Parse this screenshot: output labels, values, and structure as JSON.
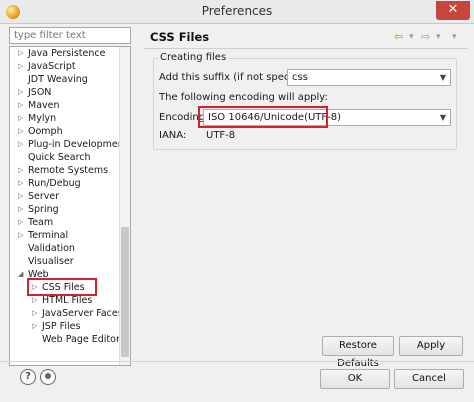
{
  "window": {
    "title": "Preferences",
    "close_glyph": "✕"
  },
  "tree": {
    "filter_placeholder": "type filter text",
    "items": [
      {
        "label": "Java Persistence",
        "expandable": true,
        "depth": 0
      },
      {
        "label": "JavaScript",
        "expandable": true,
        "depth": 0
      },
      {
        "label": "JDT Weaving",
        "expandable": false,
        "depth": 0
      },
      {
        "label": "JSON",
        "expandable": true,
        "depth": 0
      },
      {
        "label": "Maven",
        "expandable": true,
        "depth": 0
      },
      {
        "label": "Mylyn",
        "expandable": true,
        "depth": 0
      },
      {
        "label": "Oomph",
        "expandable": true,
        "depth": 0
      },
      {
        "label": "Plug-in Development",
        "expandable": true,
        "depth": 0
      },
      {
        "label": "Quick Search",
        "expandable": false,
        "depth": 0
      },
      {
        "label": "Remote Systems",
        "expandable": true,
        "depth": 0
      },
      {
        "label": "Run/Debug",
        "expandable": true,
        "depth": 0
      },
      {
        "label": "Server",
        "expandable": true,
        "depth": 0
      },
      {
        "label": "Spring",
        "expandable": true,
        "depth": 0
      },
      {
        "label": "Team",
        "expandable": true,
        "depth": 0
      },
      {
        "label": "Terminal",
        "expandable": true,
        "depth": 0
      },
      {
        "label": "Validation",
        "expandable": false,
        "depth": 0
      },
      {
        "label": "Visualiser",
        "expandable": false,
        "depth": 0
      },
      {
        "label": "Web",
        "expandable": true,
        "expanded": true,
        "depth": 0
      },
      {
        "label": "CSS Files",
        "expandable": true,
        "depth": 1,
        "selected": true
      },
      {
        "label": "HTML Files",
        "expandable": true,
        "depth": 1
      },
      {
        "label": "JavaServer Faces To",
        "expandable": true,
        "depth": 1
      },
      {
        "label": "JSP Files",
        "expandable": true,
        "depth": 1
      },
      {
        "label": "Web Page Editor",
        "expandable": false,
        "depth": 1
      }
    ]
  },
  "page": {
    "title": "CSS Files",
    "nav_back_glyph": "⇦",
    "nav_forward_glyph": "⇨",
    "nav_menu_glyph": "▾",
    "group_title": "Creating files",
    "suffix_label": "Add this suffix (if not specified):",
    "suffix_value": "css",
    "encoding_intro": "The following encoding will apply:",
    "encoding_label": "Encoding:",
    "encoding_value": "ISO 10646/Unicode(UTF-8)",
    "iana_label": "IANA:",
    "iana_value": "UTF-8",
    "caret_glyph": "▼"
  },
  "buttons": {
    "restore_defaults": "Restore Defaults",
    "apply": "Apply",
    "ok": "OK",
    "cancel": "Cancel"
  },
  "icons": {
    "help": "?",
    "help_name": "help-icon",
    "import_export_name": "import-export-icon"
  },
  "colors": {
    "highlight": "#d6212c",
    "nav_accent": "#c48a1c"
  }
}
